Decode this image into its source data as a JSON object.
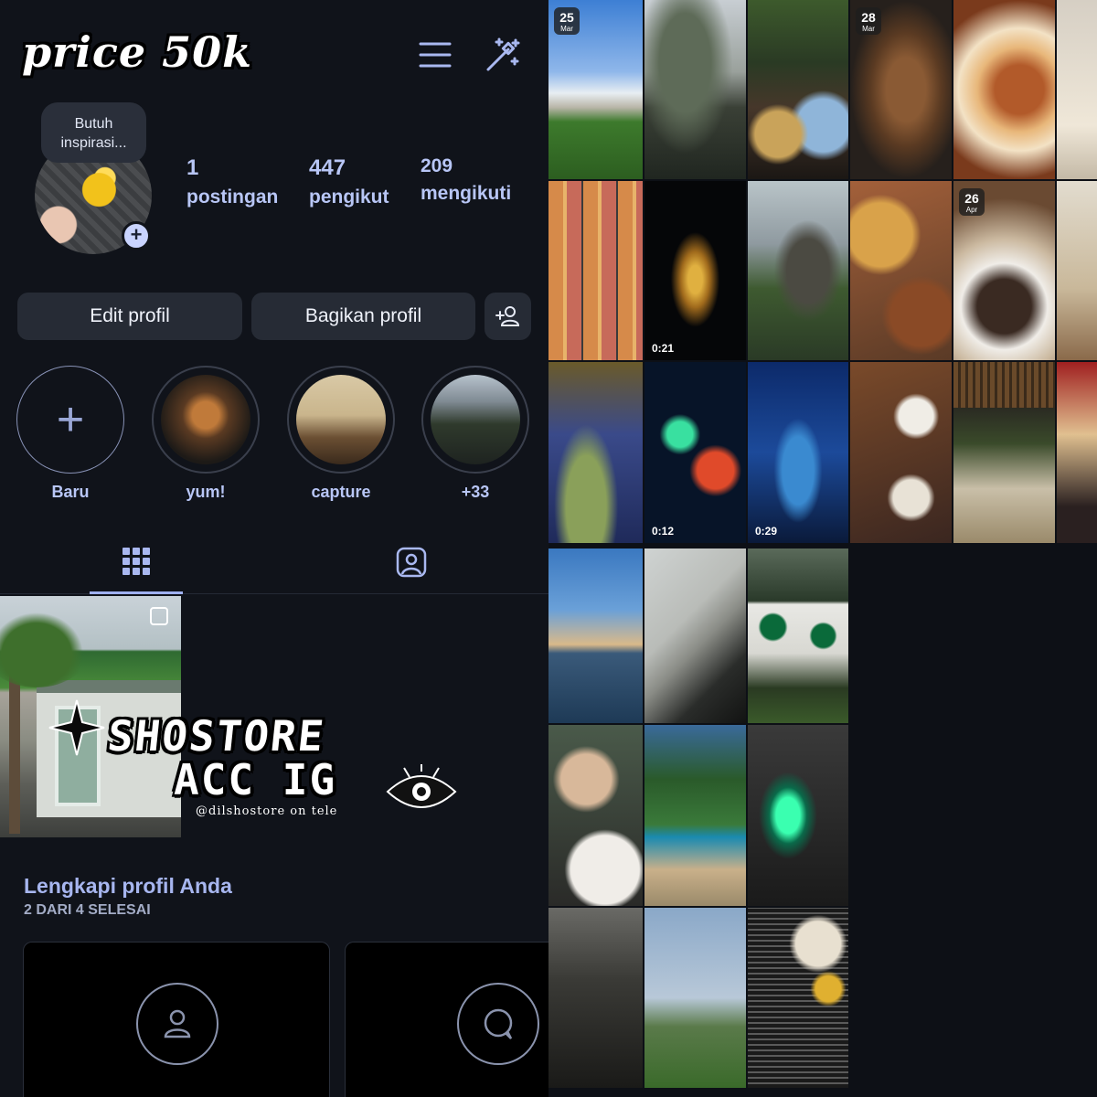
{
  "header": {
    "price_text": "price 50k"
  },
  "profile": {
    "bubble_text": "Butuh inspirasi...",
    "stats": {
      "posts_count": "1",
      "posts_label": "postingan",
      "followers_count": "447",
      "followers_label": "pengikut",
      "following_count": "209",
      "following_label": "mengikuti"
    },
    "buttons": {
      "edit": "Edit profil",
      "share": "Bagikan profil"
    }
  },
  "highlights": [
    {
      "label": "Baru"
    },
    {
      "label": "yum!"
    },
    {
      "label": "capture"
    },
    {
      "label": "+33"
    }
  ],
  "watermark": {
    "line1": "SHOSTORE",
    "line2": "ACC IG",
    "handle": "@dilshostore on  tele"
  },
  "complete_profile": {
    "title": "Lengkapi profil Anda",
    "subtitle": "2 DARI 4 SELESAI"
  },
  "grid_labels": {
    "t1_day": "25",
    "t1_month": "Mar",
    "t4_day": "28",
    "t4_month": "Mar",
    "t11_day": "26",
    "t11_month": "Apr",
    "t8_dur": "0:21",
    "t14_dur": "0:12",
    "t15_dur": "0:29"
  },
  "icons": [
    "menu-icon",
    "magic-wand-icon",
    "add-user-icon",
    "grid-icon",
    "tagged-icon",
    "person-icon",
    "chat-icon",
    "plus-icon",
    "multi-post-icon"
  ],
  "colors": {
    "accent": "#9fb0f0",
    "background": "#10131a",
    "button": "#262b35"
  }
}
